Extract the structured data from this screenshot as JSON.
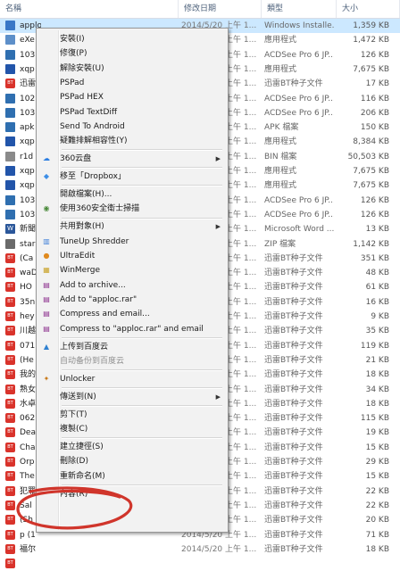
{
  "header": {
    "name": "名稱",
    "date": "修改日期",
    "type": "類型",
    "size": "大小"
  },
  "rows": [
    {
      "icon": "msi-icon",
      "color": "#3a77c7",
      "name": "apploc.msi",
      "date": "2014/5/20 上午 1...",
      "type": "Windows Installe...",
      "size": "1,359 KB",
      "selected": true
    },
    {
      "icon": "exe-icon",
      "color": "#5d8fc9",
      "name": "eXe",
      "date": "2014/5/20 上午 1...",
      "type": "應用程式",
      "size": "1,472 KB"
    },
    {
      "icon": "acdsee-icon",
      "color": "#2f6fb0",
      "name": "103",
      "date": "2014/5/20 上午 1...",
      "type": "ACDSee Pro 6 JP...",
      "size": "126 KB"
    },
    {
      "icon": "exe-icon",
      "color": "#2255aa",
      "name": "xqp",
      "date": "2014/5/20 上午 1...",
      "type": "應用程式",
      "size": "7,675 KB"
    },
    {
      "icon": "bt-icon",
      "color": "#d9332b",
      "name": "迅雷",
      "date": "2014/5/20 上午 1...",
      "type": "迅雷BT种子文件",
      "size": "17 KB"
    },
    {
      "icon": "acdsee-icon",
      "color": "#2f6fb0",
      "name": "102",
      "date": "2014/5/20 上午 1...",
      "type": "ACDSee Pro 6 JP...",
      "size": "116 KB"
    },
    {
      "icon": "acdsee-icon",
      "color": "#2f6fb0",
      "name": "103",
      "date": "2014/5/20 上午 1...",
      "type": "ACDSee Pro 6 JP...",
      "size": "206 KB"
    },
    {
      "icon": "apk-icon",
      "color": "#2f6fb0",
      "name": "apk",
      "date": "2014/5/20 上午 1...",
      "type": "APK 檔案",
      "size": "150 KB"
    },
    {
      "icon": "exe-icon",
      "color": "#2255aa",
      "name": "xqp",
      "date": "2014/5/20 上午 1...",
      "type": "應用程式",
      "size": "8,384 KB"
    },
    {
      "icon": "bin-icon",
      "color": "#8a8a8a",
      "name": "r1d",
      "date": "2014/5/20 上午 1...",
      "type": "BIN 檔案",
      "size": "50,503 KB"
    },
    {
      "icon": "exe-icon",
      "color": "#2255aa",
      "name": "xqp",
      "date": "2014/5/20 上午 1...",
      "type": "應用程式",
      "size": "7,675 KB"
    },
    {
      "icon": "exe-icon",
      "color": "#2255aa",
      "name": "xqp",
      "date": "2014/5/20 上午 1...",
      "type": "應用程式",
      "size": "7,675 KB"
    },
    {
      "icon": "acdsee-icon",
      "color": "#2f6fb0",
      "name": "103",
      "date": "2014/5/20 上午 1...",
      "type": "ACDSee Pro 6 JP...",
      "size": "126 KB"
    },
    {
      "icon": "acdsee-icon",
      "color": "#2f6fb0",
      "name": "103",
      "date": "2014/5/20 上午 1...",
      "type": "ACDSee Pro 6 JP...",
      "size": "126 KB"
    },
    {
      "icon": "word-icon",
      "color": "#2b579a",
      "name": "新聞",
      "date": "2014/5/20 上午 1...",
      "type": "Microsoft Word ...",
      "size": "13 KB"
    },
    {
      "icon": "zip-icon",
      "color": "#6a6a6a",
      "name": "star",
      "date": "2014/5/20 上午 1...",
      "type": "ZIP 檔案",
      "size": "1,142 KB"
    },
    {
      "icon": "bt-icon",
      "color": "#d9332b",
      "name": "(Ca",
      "date": "2014/5/20 上午 1...",
      "type": "迅雷BT种子文件",
      "size": "351 KB"
    },
    {
      "icon": "bt-icon",
      "color": "#d9332b",
      "name": "waD",
      "date": "2014/5/20 上午 1...",
      "type": "迅雷BT种子文件",
      "size": "48 KB"
    },
    {
      "icon": "bt-icon",
      "color": "#d9332b",
      "name": "HO",
      "date": "2014/5/20 上午 1...",
      "type": "迅雷BT种子文件",
      "size": "61 KB"
    },
    {
      "icon": "bt-icon",
      "color": "#d9332b",
      "name": "35n",
      "date": "2014/5/20 上午 1...",
      "type": "迅雷BT种子文件",
      "size": "16 KB"
    },
    {
      "icon": "bt-icon",
      "color": "#d9332b",
      "name": "hey",
      "date": "2014/5/20 上午 1...",
      "type": "迅雷BT种子文件",
      "size": "9 KB"
    },
    {
      "icon": "bt-icon",
      "color": "#d9332b",
      "name": "川越",
      "date": "2014/5/20 上午 1...",
      "type": "迅雷BT种子文件",
      "size": "35 KB"
    },
    {
      "icon": "bt-icon",
      "color": "#d9332b",
      "name": "071",
      "date": "2014/5/20 上午 1...",
      "type": "迅雷BT种子文件",
      "size": "119 KB"
    },
    {
      "icon": "bt-icon",
      "color": "#d9332b",
      "name": "(He",
      "date": "2014/5/20 上午 1...",
      "type": "迅雷BT种子文件",
      "size": "21 KB"
    },
    {
      "icon": "bt-icon",
      "color": "#d9332b",
      "name": "我的",
      "date": "2014/5/20 上午 1...",
      "type": "迅雷BT种子文件",
      "size": "18 KB"
    },
    {
      "icon": "bt-icon",
      "color": "#d9332b",
      "name": "熟女",
      "date": "2014/5/20 上午 1...",
      "type": "迅雷BT种子文件",
      "size": "34 KB"
    },
    {
      "icon": "bt-icon",
      "color": "#d9332b",
      "name": "水卓",
      "date": "2014/5/20 上午 1...",
      "type": "迅雷BT种子文件",
      "size": "18 KB"
    },
    {
      "icon": "bt-icon",
      "color": "#d9332b",
      "name": "062",
      "date": "2014/5/20 上午 1...",
      "type": "迅雷BT种子文件",
      "size": "115 KB"
    },
    {
      "icon": "bt-icon",
      "color": "#d9332b",
      "name": "Dea",
      "date": "2014/5/20 上午 1...",
      "type": "迅雷BT种子文件",
      "size": "19 KB"
    },
    {
      "icon": "bt-icon",
      "color": "#d9332b",
      "name": "Cha",
      "date": "2014/5/20 上午 1...",
      "type": "迅雷BT种子文件",
      "size": "15 KB"
    },
    {
      "icon": "bt-icon",
      "color": "#d9332b",
      "name": "Orp",
      "date": "2014/5/20 上午 1...",
      "type": "迅雷BT种子文件",
      "size": "29 KB"
    },
    {
      "icon": "bt-icon",
      "color": "#d9332b",
      "name": "The",
      "date": "2014/5/20 上午 1...",
      "type": "迅雷BT种子文件",
      "size": "15 KB"
    },
    {
      "icon": "bt-icon",
      "color": "#d9332b",
      "name": "犯罪",
      "date": "2014/5/20 上午 1...",
      "type": "迅雷BT种子文件",
      "size": "22 KB"
    },
    {
      "icon": "bt-icon",
      "color": "#d9332b",
      "name": "Sal",
      "date": "2014/5/20 上午 1...",
      "type": "迅雷BT种子文件",
      "size": "22 KB"
    },
    {
      "icon": "bt-icon",
      "color": "#d9332b",
      "name": "(Sh",
      "date": "2014/5/20 上午 1...",
      "type": "迅雷BT种子文件",
      "size": "20 KB"
    },
    {
      "icon": "bt-icon",
      "color": "#d9332b",
      "name": "p (1",
      "date": "2014/5/20 上午 1...",
      "type": "迅雷BT种子文件",
      "size": "71 KB"
    },
    {
      "icon": "bt-icon",
      "color": "#d9332b",
      "name": "福尔",
      "date": "2014/5/20 上午 1...",
      "type": "迅雷BT种子文件",
      "size": "18 KB"
    },
    {
      "icon": "bt-icon",
      "color": "#d9332b",
      "name": "",
      "date": "",
      "type": "",
      "size": ""
    }
  ],
  "menu": [
    {
      "kind": "item",
      "label": "安裝(I)",
      "icon": ""
    },
    {
      "kind": "item",
      "label": "修復(P)",
      "icon": ""
    },
    {
      "kind": "item",
      "label": "解除安裝(U)",
      "icon": ""
    },
    {
      "kind": "item",
      "label": "PSPad",
      "icon": ""
    },
    {
      "kind": "item",
      "label": "PSPad HEX",
      "icon": ""
    },
    {
      "kind": "item",
      "label": "PSPad TextDiff",
      "icon": ""
    },
    {
      "kind": "item",
      "label": "Send To Android",
      "icon": ""
    },
    {
      "kind": "item",
      "label": "疑難排解相容性(Y)",
      "icon": ""
    },
    {
      "kind": "sep"
    },
    {
      "kind": "item",
      "label": "360云盘",
      "icon": "cloud-icon",
      "arrow": true
    },
    {
      "kind": "sep"
    },
    {
      "kind": "item",
      "label": "移至「Dropbox」",
      "icon": "dropbox-icon"
    },
    {
      "kind": "sep"
    },
    {
      "kind": "item",
      "label": "開啟檔案(H)...",
      "icon": ""
    },
    {
      "kind": "item",
      "label": "使用360安全衛士掃描",
      "icon": "shield-icon"
    },
    {
      "kind": "sep"
    },
    {
      "kind": "item",
      "label": "共用對象(H)",
      "icon": "",
      "arrow": true
    },
    {
      "kind": "item",
      "label": "TuneUp Shredder",
      "icon": "shredder-icon"
    },
    {
      "kind": "item",
      "label": "UltraEdit",
      "icon": "ultraedit-icon"
    },
    {
      "kind": "item",
      "label": "WinMerge",
      "icon": "winmerge-icon"
    },
    {
      "kind": "item",
      "label": "Add to archive...",
      "icon": "winrar-icon"
    },
    {
      "kind": "item",
      "label": "Add to \"apploc.rar\"",
      "icon": "winrar-icon"
    },
    {
      "kind": "item",
      "label": "Compress and email...",
      "icon": "winrar-icon"
    },
    {
      "kind": "item",
      "label": "Compress to \"apploc.rar\" and email",
      "icon": "winrar-icon"
    },
    {
      "kind": "sep"
    },
    {
      "kind": "item",
      "label": "上传到百度云",
      "icon": "upload-cloud-icon"
    },
    {
      "kind": "item",
      "label": "自动备份到百度云",
      "icon": "",
      "disabled": true
    },
    {
      "kind": "sep"
    },
    {
      "kind": "item",
      "label": "Unlocker",
      "icon": "wand-icon"
    },
    {
      "kind": "sep"
    },
    {
      "kind": "item",
      "label": "傳送到(N)",
      "icon": "",
      "arrow": true
    },
    {
      "kind": "sep"
    },
    {
      "kind": "item",
      "label": "剪下(T)",
      "icon": ""
    },
    {
      "kind": "item",
      "label": "複製(C)",
      "icon": ""
    },
    {
      "kind": "sep"
    },
    {
      "kind": "item",
      "label": "建立捷徑(S)",
      "icon": ""
    },
    {
      "kind": "item",
      "label": "刪除(D)",
      "icon": ""
    },
    {
      "kind": "item",
      "label": "重新命名(M)",
      "icon": ""
    },
    {
      "kind": "sep"
    },
    {
      "kind": "item",
      "label": "內容(R)",
      "icon": ""
    }
  ],
  "colors": {
    "annotation": "#d0352b",
    "selection": "#cce8ff",
    "menu_bg": "#f2f2f2"
  }
}
